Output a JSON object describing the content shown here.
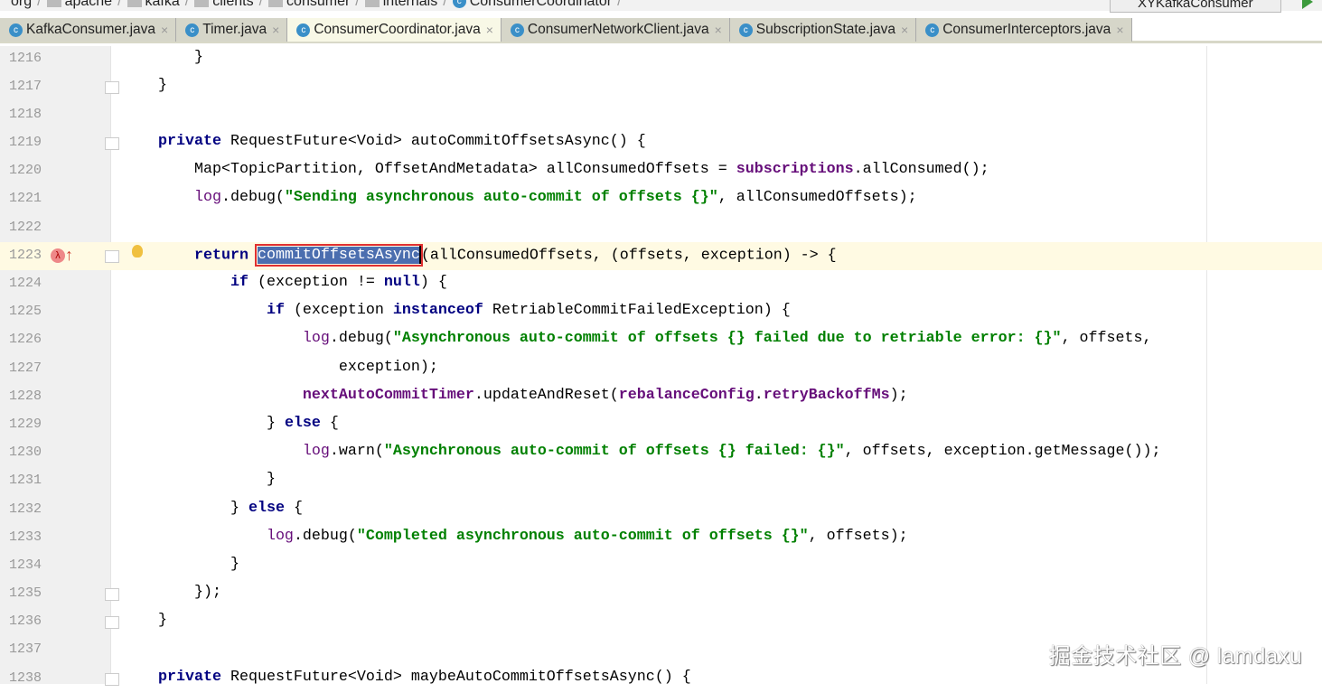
{
  "breadcrumb": [
    "org",
    "apache",
    "kafka",
    "clients",
    "consumer",
    "internals",
    "ConsumerCoordinator"
  ],
  "run_config": "XYKafkaConsumer",
  "tabs": [
    {
      "label": "KafkaConsumer.java",
      "active": false
    },
    {
      "label": "Timer.java",
      "active": false
    },
    {
      "label": "ConsumerCoordinator.java",
      "active": true
    },
    {
      "label": "ConsumerNetworkClient.java",
      "active": false
    },
    {
      "label": "SubscriptionState.java",
      "active": false
    },
    {
      "label": "ConsumerInterceptors.java",
      "active": false
    }
  ],
  "close_glyph": "×",
  "current_line": 1223,
  "lines": [
    {
      "n": 1216,
      "t": [
        [
          "p",
          "    }"
        ]
      ]
    },
    {
      "n": 1217,
      "fold": true,
      "t": [
        [
          "p",
          "}"
        ]
      ]
    },
    {
      "n": 1218,
      "t": []
    },
    {
      "n": 1219,
      "fold": true,
      "t": [
        [
          "k",
          "private "
        ],
        [
          "p",
          "RequestFuture<Void> autoCommitOffsetsAsync() {"
        ]
      ]
    },
    {
      "n": 1220,
      "t": [
        [
          "p",
          "    Map<TopicPartition, OffsetAndMetadata> allConsumedOffsets = "
        ],
        [
          "f",
          "subscriptions"
        ],
        [
          "p",
          ".allConsumed();"
        ]
      ]
    },
    {
      "n": 1221,
      "t": [
        [
          "l",
          "    log"
        ],
        [
          "p",
          ".debug("
        ],
        [
          "s",
          "\"Sending asynchronous auto-commit of offsets {}\""
        ],
        [
          "p",
          ", allConsumedOffsets);"
        ]
      ]
    },
    {
      "n": 1222,
      "t": []
    },
    {
      "n": 1223,
      "fold": true,
      "icons": true,
      "t": [
        [
          "k",
          "    return "
        ],
        [
          "sel",
          "commitOffsetsAsync"
        ],
        [
          "caret",
          ""
        ],
        [
          "p",
          "(allConsumedOffsets, (offsets, exception) -> {"
        ]
      ]
    },
    {
      "n": 1224,
      "t": [
        [
          "k",
          "        if "
        ],
        [
          "p",
          "(exception != "
        ],
        [
          "k",
          "null"
        ],
        [
          "p",
          ") {"
        ]
      ]
    },
    {
      "n": 1225,
      "t": [
        [
          "k",
          "            if "
        ],
        [
          "p",
          "(exception "
        ],
        [
          "k",
          "instanceof "
        ],
        [
          "p",
          "RetriableCommitFailedException) {"
        ]
      ]
    },
    {
      "n": 1226,
      "t": [
        [
          "l",
          "                log"
        ],
        [
          "p",
          ".debug("
        ],
        [
          "s",
          "\"Asynchronous auto-commit of offsets {} failed due to retriable error: {}\""
        ],
        [
          "p",
          ", offsets,"
        ]
      ]
    },
    {
      "n": 1227,
      "t": [
        [
          "p",
          "                    exception);"
        ]
      ]
    },
    {
      "n": 1228,
      "t": [
        [
          "f",
          "                nextAutoCommitTimer"
        ],
        [
          "p",
          ".updateAndReset("
        ],
        [
          "f",
          "rebalanceConfig"
        ],
        [
          "p",
          "."
        ],
        [
          "f",
          "retryBackoffMs"
        ],
        [
          "p",
          ");"
        ]
      ]
    },
    {
      "n": 1229,
      "t": [
        [
          "p",
          "            } "
        ],
        [
          "k",
          "else "
        ],
        [
          "p",
          "{"
        ]
      ]
    },
    {
      "n": 1230,
      "t": [
        [
          "l",
          "                log"
        ],
        [
          "p",
          ".warn("
        ],
        [
          "s",
          "\"Asynchronous auto-commit of offsets {} failed: {}\""
        ],
        [
          "p",
          ", offsets, exception.getMessage());"
        ]
      ]
    },
    {
      "n": 1231,
      "t": [
        [
          "p",
          "            }"
        ]
      ]
    },
    {
      "n": 1232,
      "t": [
        [
          "p",
          "        } "
        ],
        [
          "k",
          "else "
        ],
        [
          "p",
          "{"
        ]
      ]
    },
    {
      "n": 1233,
      "t": [
        [
          "l",
          "            log"
        ],
        [
          "p",
          ".debug("
        ],
        [
          "s",
          "\"Completed asynchronous auto-commit of offsets {}\""
        ],
        [
          "p",
          ", offsets);"
        ]
      ]
    },
    {
      "n": 1234,
      "t": [
        [
          "p",
          "        }"
        ]
      ]
    },
    {
      "n": 1235,
      "fold": true,
      "t": [
        [
          "p",
          "    });"
        ]
      ]
    },
    {
      "n": 1236,
      "fold": true,
      "t": [
        [
          "p",
          "}"
        ]
      ]
    },
    {
      "n": 1237,
      "t": []
    },
    {
      "n": 1238,
      "fold": true,
      "t": [
        [
          "k",
          "private "
        ],
        [
          "p",
          "RequestFuture<Void> maybeAutoCommitOffsetsAsync() {"
        ]
      ]
    }
  ],
  "watermark": "掘金技术社区 @ lamdaxu"
}
